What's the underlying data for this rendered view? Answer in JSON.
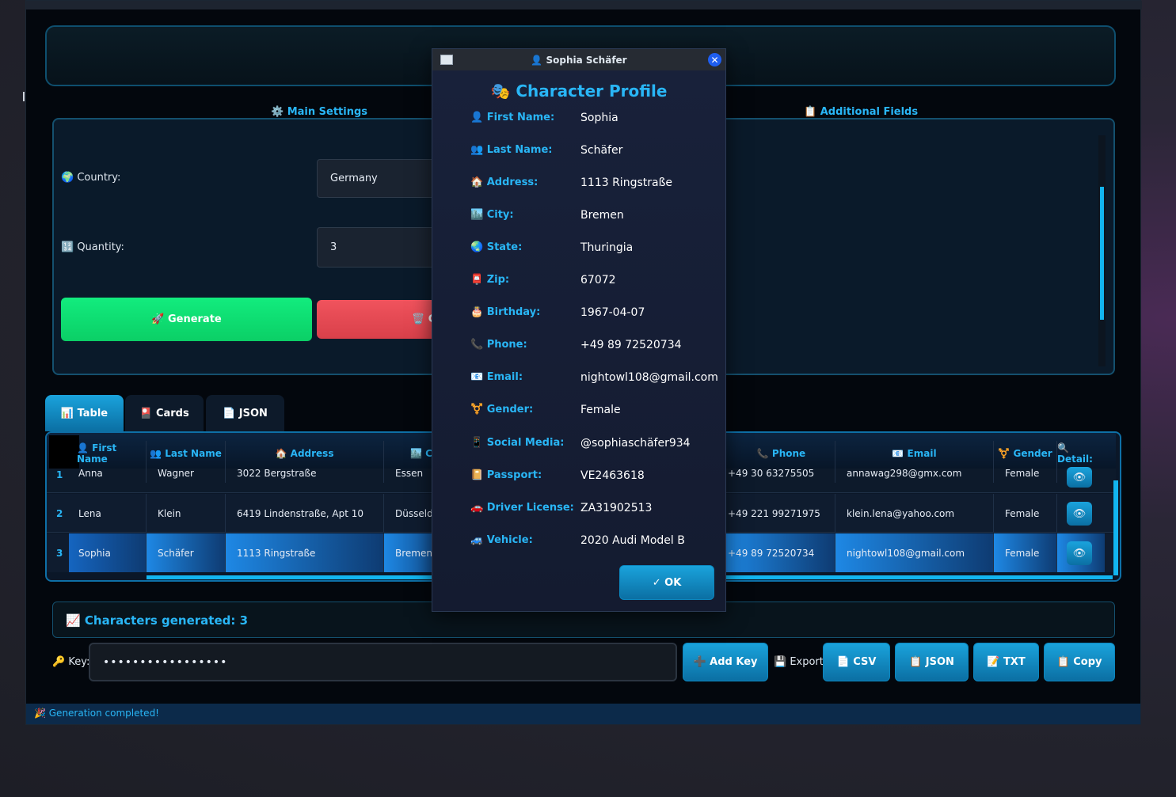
{
  "app": {
    "banner_text": "",
    "main_settings_title": "⚙️ Main Settings",
    "additional_fields_title": "📋 Additional Fields",
    "country_label": "🌍 Country:",
    "country_value": "Germany",
    "quantity_label": "🔢 Quantity:",
    "quantity_value": "3",
    "generate_label": "🚀 Generate",
    "clear_label": "🗑️ C"
  },
  "tabs": [
    {
      "label": "📊 Table"
    },
    {
      "label": "🎴 Cards"
    },
    {
      "label": "📄 JSON"
    }
  ],
  "table": {
    "headers": {
      "first_name": "👤 First Name",
      "last_name": "👥 Last Name",
      "address": "🏠 Address",
      "city": "🏙️ C",
      "phone": "📞 Phone",
      "email": "📧 Email",
      "gender": "⚧️ Gender",
      "details": "🔍 Detail:"
    },
    "rows": [
      {
        "n": "1",
        "first": "Anna",
        "last": "Wagner",
        "address": "3022 Bergstraße",
        "city": "Essen",
        "phone": "+49 30 63275505",
        "email": "annawag298@gmx.com",
        "gender": "Female"
      },
      {
        "n": "2",
        "first": "Lena",
        "last": "Klein",
        "address": "6419 Lindenstraße, Apt 10",
        "city": "Düsseld",
        "phone": "+49 221 99271975",
        "email": "klein.lena@yahoo.com",
        "gender": "Female"
      },
      {
        "n": "3",
        "first": "Sophia",
        "last": "Schäfer",
        "address": "1113 Ringstraße",
        "city": "Bremen",
        "phone": "+49 89 72520734",
        "email": "nightowl108@gmail.com",
        "gender": "Female"
      }
    ]
  },
  "stats": {
    "text": "📈 Characters generated: 3"
  },
  "footer": {
    "key_label": "🔑 Key:",
    "key_value": "•••••••••••••••••",
    "add_key": "➕ Add Key",
    "export_label": "💾 Export:",
    "csv": "📄 CSV",
    "json": "📋 JSON",
    "txt": "📝 TXT",
    "copy": "📋 Copy"
  },
  "status": {
    "text": "🎉 Generation completed!"
  },
  "dialog": {
    "title": "👤 Sophia Schäfer",
    "heading": "🎭 Character Profile",
    "ok_label": "✓ OK",
    "fields": [
      {
        "label": "👤 First Name:",
        "value": "Sophia"
      },
      {
        "label": "👥 Last Name:",
        "value": "Schäfer"
      },
      {
        "label": "🏠 Address:",
        "value": "1113 Ringstraße"
      },
      {
        "label": "🏙️ City:",
        "value": "Bremen"
      },
      {
        "label": "🌏 State:",
        "value": "Thuringia"
      },
      {
        "label": "📮 Zip:",
        "value": "67072"
      },
      {
        "label": "🎂 Birthday:",
        "value": "1967-04-07"
      },
      {
        "label": "📞 Phone:",
        "value": "+49 89 72520734"
      },
      {
        "label": "📧 Email:",
        "value": "nightowl108@gmail.com"
      },
      {
        "label": "⚧️ Gender:",
        "value": "Female"
      },
      {
        "label": "📱 Social Media:",
        "value": "@sophiaschäfer934"
      },
      {
        "label": "📔 Passport:",
        "value": "VE2463618"
      },
      {
        "label": "🚗 Driver License:",
        "value": "ZA31902513"
      },
      {
        "label": "🚙 Vehicle:",
        "value": "2020 Audi Model B"
      }
    ]
  },
  "colors": {
    "accent": "#29b6f6",
    "generate": "#00e676",
    "clear": "#ef5350",
    "selected_row": "#1565c0"
  }
}
